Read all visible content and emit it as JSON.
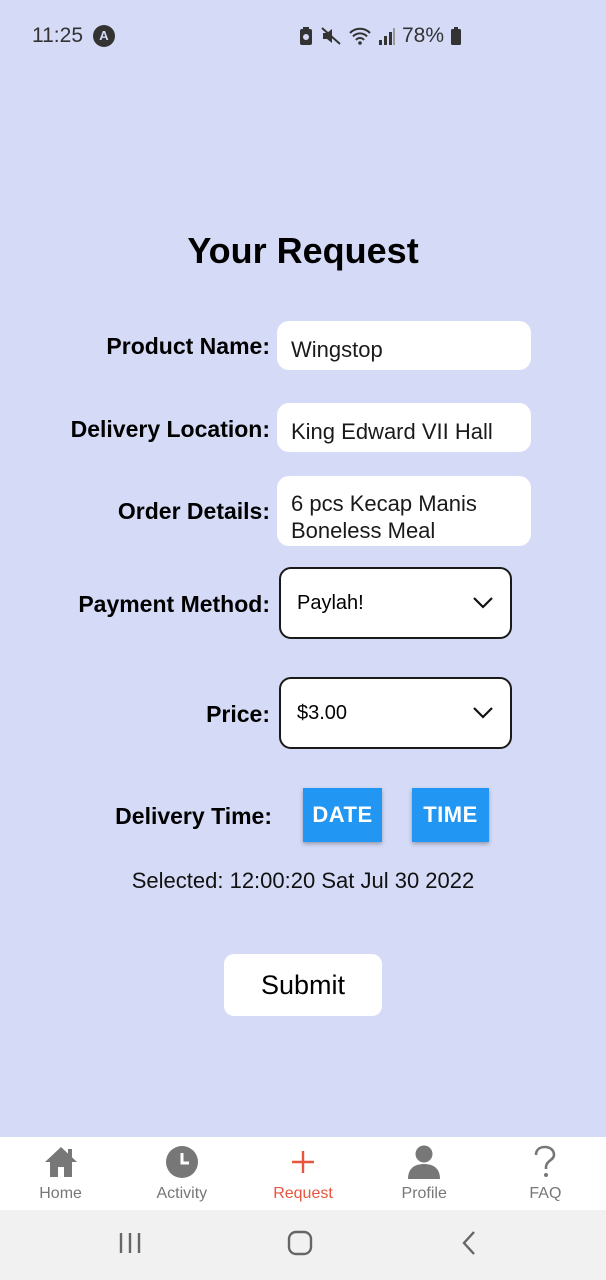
{
  "status_bar": {
    "time": "11:25",
    "app_icon_letter": "A",
    "battery": "78%"
  },
  "page": {
    "title": "Your Request"
  },
  "form": {
    "product_name": {
      "label": "Product Name:",
      "value": "Wingstop"
    },
    "delivery_location": {
      "label": "Delivery Location:",
      "value": "King Edward VII Hall"
    },
    "order_details": {
      "label": "Order Details:",
      "value": "6 pcs Kecap Manis Boneless Meal"
    },
    "payment_method": {
      "label": "Payment Method:",
      "value": "Paylah!"
    },
    "price": {
      "label": "Price:",
      "value": "$3.00"
    },
    "delivery_time": {
      "label": "Delivery Time:",
      "date_button": "DATE",
      "time_button": "TIME"
    },
    "selected_text": "Selected: 12:00:20 Sat Jul 30 2022",
    "submit_label": "Submit"
  },
  "bottom_nav": {
    "items": [
      {
        "label": "Home",
        "icon": "home-icon"
      },
      {
        "label": "Activity",
        "icon": "clock-icon"
      },
      {
        "label": "Request",
        "icon": "plus-icon",
        "active": true
      },
      {
        "label": "Profile",
        "icon": "person-icon"
      },
      {
        "label": "FAQ",
        "icon": "question-icon"
      }
    ]
  },
  "colors": {
    "background": "#d5dbf7",
    "accent_blue": "#2196f3",
    "active_nav": "#e8553e"
  }
}
